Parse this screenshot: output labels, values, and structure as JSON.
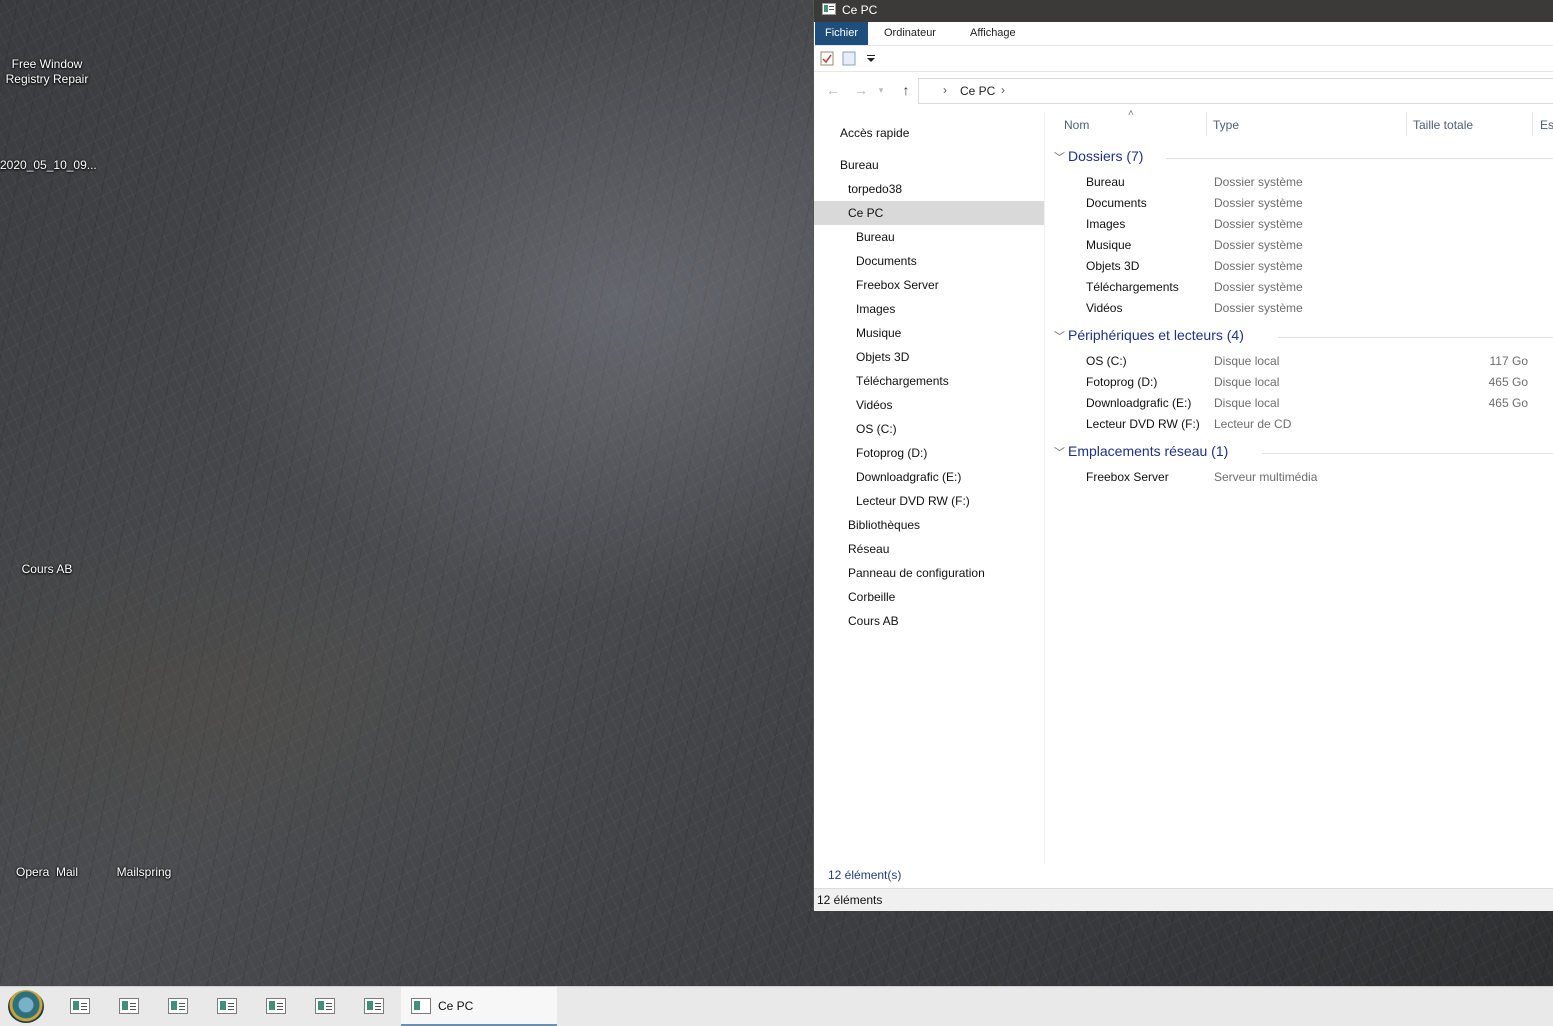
{
  "desktop": {
    "icons": [
      {
        "label": "Free Window\nRegistry Repair"
      },
      {
        "label": "2020_05_10_09..."
      },
      {
        "label": "Cours AB"
      },
      {
        "label": "Opera  Mail"
      },
      {
        "label": "Mailspring"
      }
    ]
  },
  "window": {
    "title": "Ce PC",
    "ribbon_tabs": [
      "Fichier",
      "Ordinateur",
      "Affichage"
    ],
    "address": {
      "crumbs": [
        "Ce PC"
      ]
    },
    "nav_pane": [
      {
        "label": "Accès rapide"
      },
      {
        "label": "Bureau"
      },
      {
        "label": "torpedo38"
      },
      {
        "label": "Ce PC"
      },
      {
        "label": "Bureau"
      },
      {
        "label": "Documents"
      },
      {
        "label": "Freebox Server"
      },
      {
        "label": "Images"
      },
      {
        "label": "Musique"
      },
      {
        "label": "Objets 3D"
      },
      {
        "label": "Téléchargements"
      },
      {
        "label": "Vidéos"
      },
      {
        "label": "OS (C:)"
      },
      {
        "label": "Fotoprog (D:)"
      },
      {
        "label": "Downloadgrafic (E:)"
      },
      {
        "label": "Lecteur DVD RW (F:)"
      },
      {
        "label": "Bibliothèques"
      },
      {
        "label": "Réseau"
      },
      {
        "label": "Panneau de configuration"
      },
      {
        "label": "Corbeille"
      },
      {
        "label": "Cours AB"
      }
    ],
    "columns": [
      "Nom",
      "Type",
      "Taille totale",
      "Es"
    ],
    "groups": [
      {
        "title": "Dossiers (7)",
        "items": [
          {
            "name": "Bureau",
            "type": "Dossier système",
            "size": ""
          },
          {
            "name": "Documents",
            "type": "Dossier système",
            "size": ""
          },
          {
            "name": "Images",
            "type": "Dossier système",
            "size": ""
          },
          {
            "name": "Musique",
            "type": "Dossier système",
            "size": ""
          },
          {
            "name": "Objets 3D",
            "type": "Dossier système",
            "size": ""
          },
          {
            "name": "Téléchargements",
            "type": "Dossier système",
            "size": ""
          },
          {
            "name": "Vidéos",
            "type": "Dossier système",
            "size": ""
          }
        ]
      },
      {
        "title": "Périphériques et lecteurs (4)",
        "items": [
          {
            "name": "OS (C:)",
            "type": "Disque local",
            "size": "117 Go"
          },
          {
            "name": "Fotoprog (D:)",
            "type": "Disque local",
            "size": "465 Go"
          },
          {
            "name": "Downloadgrafic (E:)",
            "type": "Disque local",
            "size": "465 Go"
          },
          {
            "name": "Lecteur DVD RW (F:)",
            "type": "Lecteur de CD",
            "size": ""
          }
        ]
      },
      {
        "title": "Emplacements réseau (1)",
        "items": [
          {
            "name": "Freebox Server",
            "type": "Serveur multimédia",
            "size": ""
          }
        ]
      }
    ],
    "status_inner": "12 élément(s)",
    "status_outer": "12 éléments"
  },
  "taskbar": {
    "active_label": "Ce PC"
  },
  "colors": {
    "ribbon_active": "#1e4e7c",
    "group_header": "#1e3287",
    "selection": "#d9d9d9"
  }
}
